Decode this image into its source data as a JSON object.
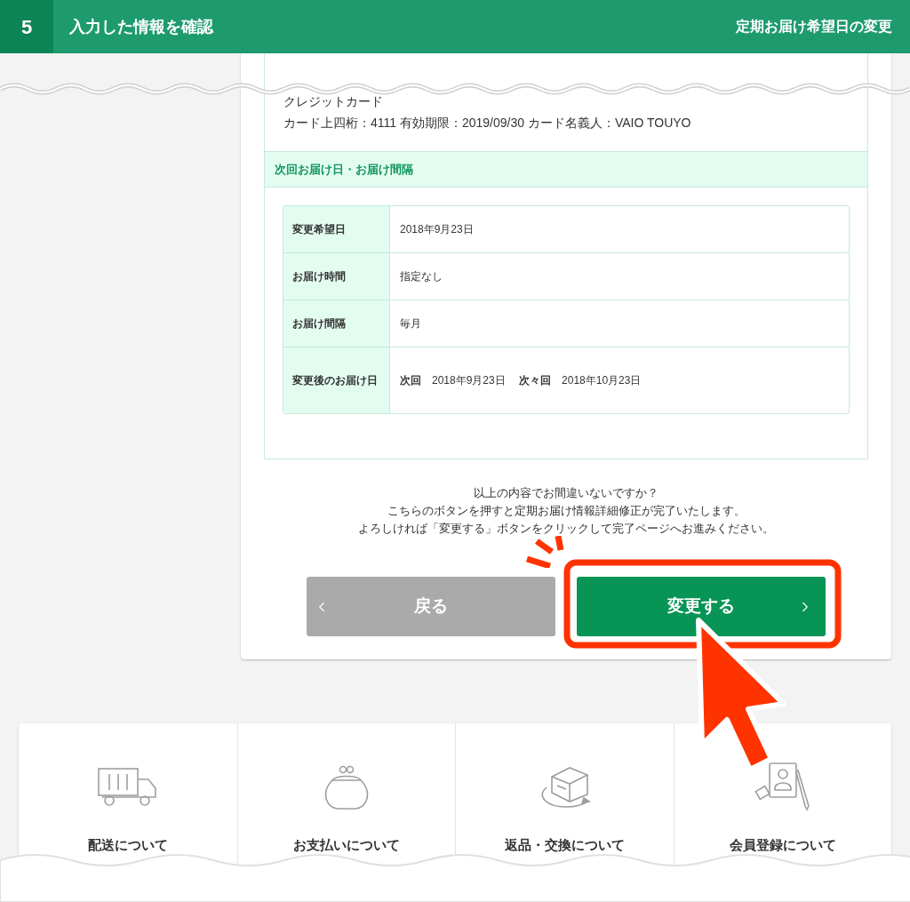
{
  "header": {
    "step": "5",
    "title": "入力した情報を確認",
    "page_title": "定期お届け希望日の変更"
  },
  "payment": {
    "method": "クレジットカード",
    "details": "カード上四桁：4111 有効期限：2019/09/30 カード名義人：VAIO TOUYO"
  },
  "delivery_section": {
    "heading": "次回お届け日・お届け間隔",
    "rows": [
      {
        "label": "変更希望日",
        "value": "2018年9月23日"
      },
      {
        "label": "お届け時間",
        "value": "指定なし"
      },
      {
        "label": "お届け間隔",
        "value": "毎月"
      },
      {
        "label": "変更後のお届け日",
        "value": "**次回**　2018年9月23日　 **次々回**　2018年10月23日"
      }
    ]
  },
  "message": [
    "以上の内容でお間違いないですか？",
    "こちらのボタンを押すと定期お届け情報詳細修正が完了いたします。",
    "よろしければ「変更する」ボタンをクリックして完了ページへお進みください。"
  ],
  "buttons": {
    "back": "戻る",
    "submit": "変更する"
  },
  "info_links": [
    {
      "label": "配送について"
    },
    {
      "label": "お支払いについて"
    },
    {
      "label": "返品・交換について"
    },
    {
      "label": "会員登録について"
    }
  ]
}
